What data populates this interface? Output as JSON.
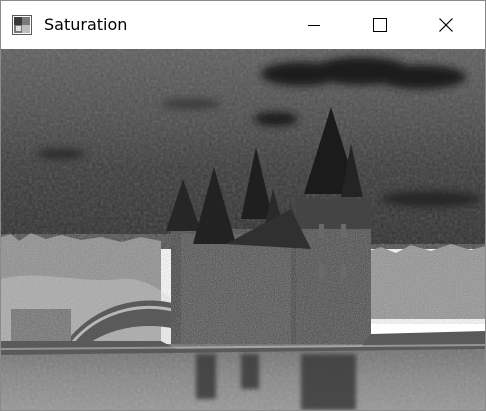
{
  "window": {
    "title": "Saturation"
  },
  "titlebar": {
    "app_icon": "opencv-window-icon",
    "minimize_icon": "minimize-icon",
    "maximize_icon": "maximize-icon",
    "close_icon": "close-icon"
  },
  "image": {
    "description_icon": "image-canvas",
    "mode": "grayscale"
  }
}
